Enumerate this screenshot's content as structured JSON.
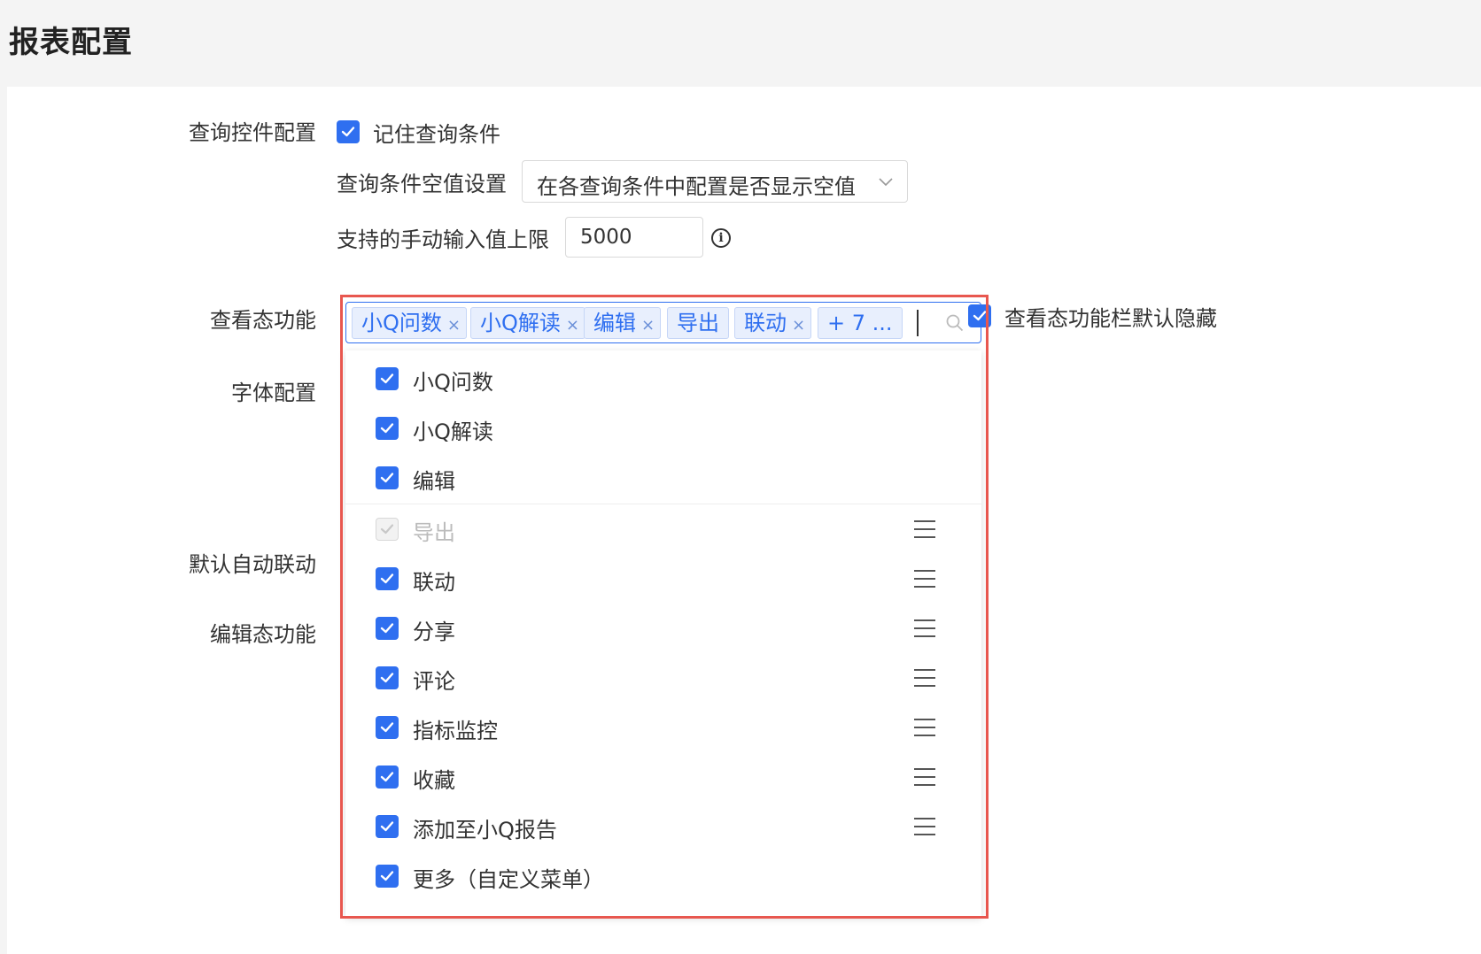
{
  "page": {
    "title": "报表配置"
  },
  "query": {
    "label": "查询控件配置",
    "remember_label": "记住查询条件",
    "empty_label": "查询条件空值设置",
    "empty_value": "在各查询条件中配置是否显示空值",
    "limit_label": "支持的手动输入值上限",
    "limit_value": "5000"
  },
  "view": {
    "label": "查看态功能",
    "tags": [
      {
        "label": "小Q问数",
        "closable": true
      },
      {
        "label": "小Q解读",
        "closable": true
      },
      {
        "label": "编辑",
        "closable": true
      },
      {
        "label": "导出",
        "closable": false
      },
      {
        "label": "联动",
        "closable": true
      },
      {
        "label": "+ 7 ...",
        "closable": false
      }
    ],
    "hide_label": "查看态功能栏默认隐藏",
    "options": [
      {
        "label": "小Q问数",
        "checked": true,
        "disabled": false,
        "draggable": false
      },
      {
        "label": "小Q解读",
        "checked": true,
        "disabled": false,
        "draggable": false
      },
      {
        "label": "编辑",
        "checked": true,
        "disabled": false,
        "draggable": false
      },
      {
        "label": "导出",
        "checked": true,
        "disabled": true,
        "draggable": true
      },
      {
        "label": "联动",
        "checked": true,
        "disabled": false,
        "draggable": true
      },
      {
        "label": "分享",
        "checked": true,
        "disabled": false,
        "draggable": true
      },
      {
        "label": "评论",
        "checked": true,
        "disabled": false,
        "draggable": true
      },
      {
        "label": "指标监控",
        "checked": true,
        "disabled": false,
        "draggable": true
      },
      {
        "label": "收藏",
        "checked": true,
        "disabled": false,
        "draggable": true
      },
      {
        "label": "添加至小Q报告",
        "checked": true,
        "disabled": false,
        "draggable": true
      },
      {
        "label": "更多（自定义菜单）",
        "checked": true,
        "disabled": false,
        "draggable": false
      }
    ]
  },
  "font": {
    "label": "字体配置"
  },
  "auto_link": {
    "label": "默认自动联动"
  },
  "edit": {
    "label": "编辑态功能"
  },
  "colors": {
    "accent": "#2f6ff0",
    "highlight": "#e8574f"
  }
}
